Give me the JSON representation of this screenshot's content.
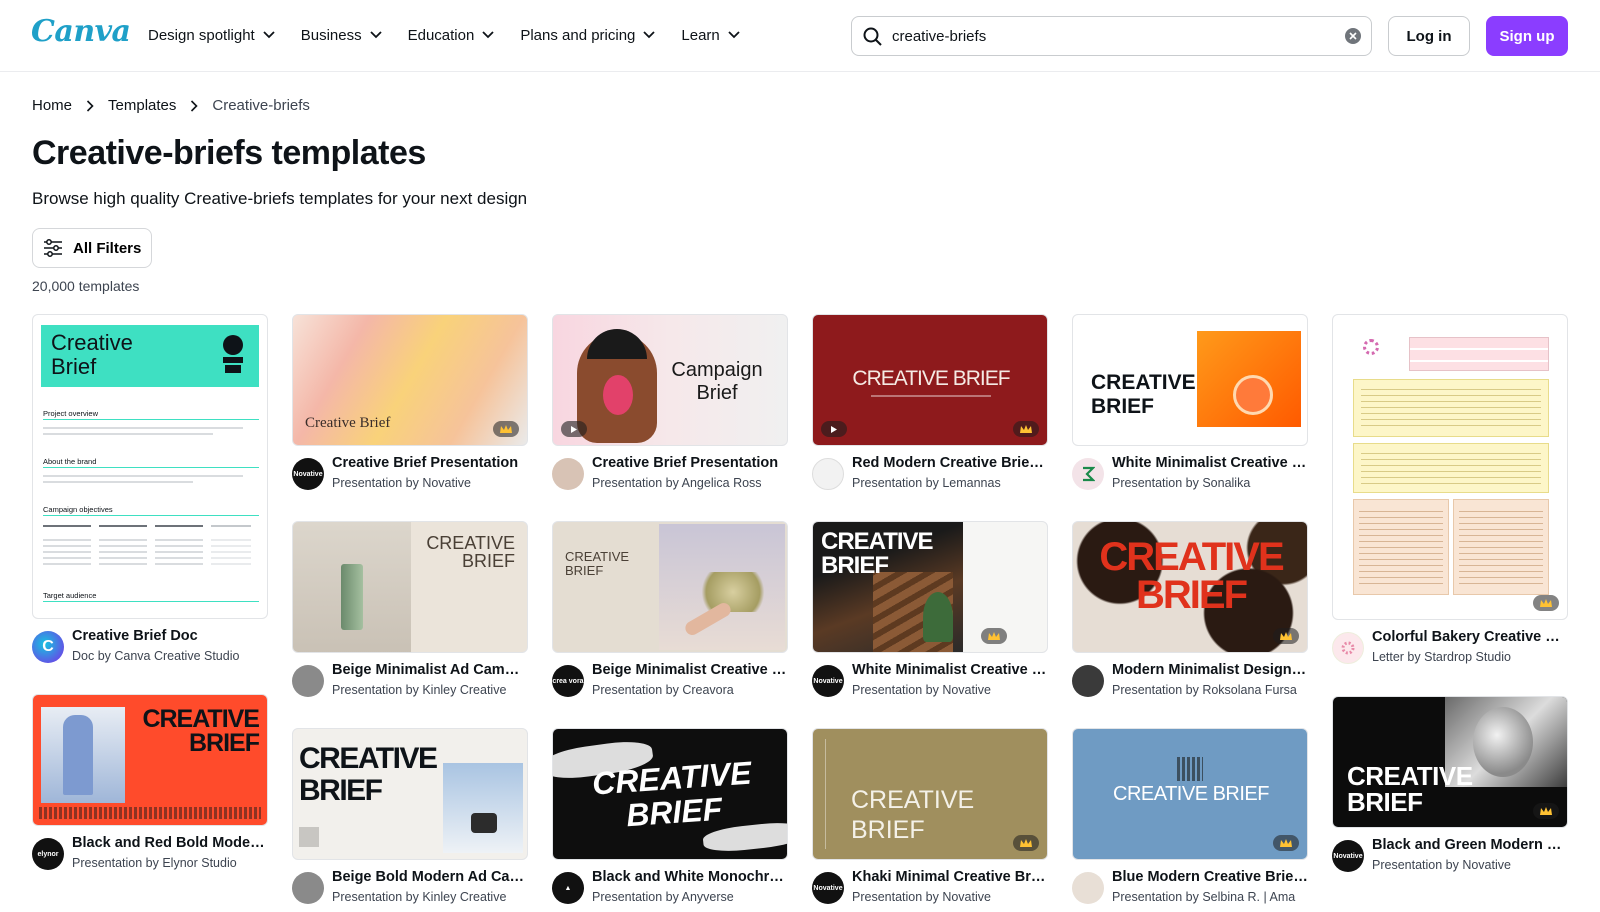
{
  "header": {
    "logo": "Canva",
    "nav": [
      "Design spotlight",
      "Business",
      "Education",
      "Plans and pricing",
      "Learn"
    ],
    "search_value": "creative-briefs",
    "login_label": "Log in",
    "signup_label": "Sign up",
    "accent_color": "#8b3dff"
  },
  "breadcrumb": [
    "Home",
    "Templates",
    "Creative-briefs"
  ],
  "page": {
    "title": "Creative-briefs templates",
    "subtitle": "Browse high quality Creative-briefs templates for your next design",
    "filters_label": "All Filters",
    "count": "20,000 templates"
  },
  "cards": [
    {
      "title": "Creative Brief Doc",
      "author": "Doc by Canva Creative Studio"
    },
    {
      "title": "Creative Brief Presentation",
      "author": "Presentation by Novative",
      "thumb_text": "Creative Brief"
    },
    {
      "title": "Creative Brief Presentation",
      "author": "Presentation by Angelica Ross",
      "thumb_text": "Campaign Brief"
    },
    {
      "title": "Red Modern Creative Brief Presentation",
      "author": "Presentation by Lemannas",
      "thumb_text": "CREATIVE BRIEF"
    },
    {
      "title": "White Minimalist Creative Brief Presentation",
      "author": "Presentation by Sonalika",
      "thumb_text": "CREATIVE BRIEF"
    },
    {
      "title": "Colorful Bakery Creative Brief Letter",
      "author": "Letter by Stardrop Studio"
    },
    {
      "title": "Beige Minimalist Ad Campaign Presentation",
      "author": "Presentation by Kinley Creative",
      "thumb_text": "CREATIVE BRIEF"
    },
    {
      "title": "Beige Minimalist Creative Brief Presentation",
      "author": "Presentation by Creavora",
      "thumb_text": "CREATIVE BRIEF"
    },
    {
      "title": "White Minimalist Creative Brief Presentation",
      "author": "Presentation by Novative",
      "thumb_text": "CREATIVE BRIEF"
    },
    {
      "title": "Modern Minimalist Design Creative Brief",
      "author": "Presentation by Roksolana Fursa",
      "thumb_text": "CREATIVE BRIEF"
    },
    {
      "title": "Black and Red Bold Modern Creative Brief",
      "author": "Presentation by Elynor Studio",
      "thumb_text": "CREATIVE BRIEF"
    },
    {
      "title": "Beige Bold Modern Ad Campaign",
      "author": "Presentation by Kinley Creative",
      "thumb_text": "CREATIVE BRIEF"
    },
    {
      "title": "Black and White Monochrome Creative Brief",
      "author": "Presentation by Anyverse",
      "thumb_text": "CREATIVE BRIEF"
    },
    {
      "title": "Khaki Minimal Creative Brief Presentation",
      "author": "Presentation by Novative",
      "thumb_text": "CREATIVE BRIEF"
    },
    {
      "title": "Blue Modern Creative Brief Presentation",
      "author": "Presentation by Selbina R. | Ama",
      "thumb_text": "CREATIVE BRIEF"
    },
    {
      "title": "Black and Green Modern Creative Brief",
      "author": "Presentation by Novative",
      "thumb_text": "CREATIVE BRIEF"
    }
  ],
  "doc_thumb": {
    "title": "Creative Brief",
    "sections": [
      "Project overview",
      "About the brand",
      "Campaign objectives",
      "Target audience"
    ]
  }
}
